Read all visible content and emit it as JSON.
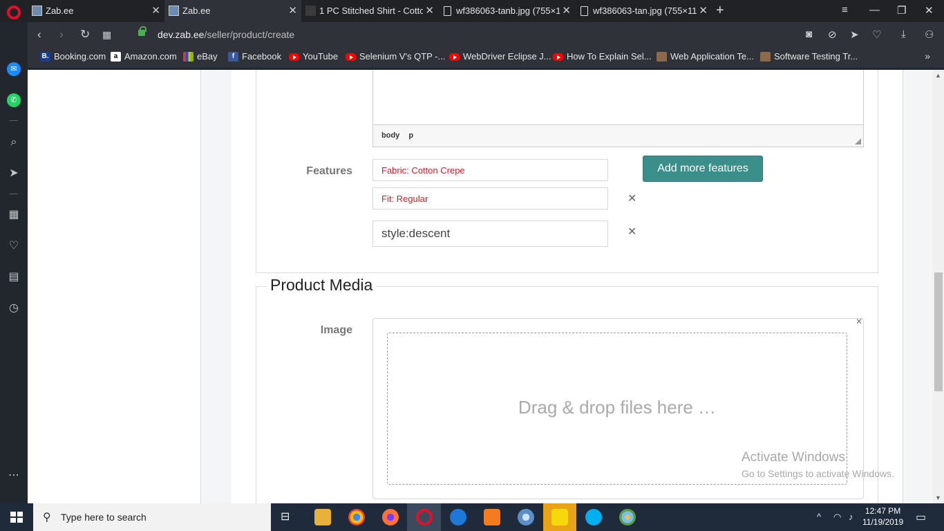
{
  "browser": {
    "tabs": [
      {
        "label": "Zab.ee",
        "active": false
      },
      {
        "label": "Zab.ee",
        "active": true
      },
      {
        "label": "1 PC Stitched Shirt - Cotton",
        "active": false
      },
      {
        "label": "wf386063-tanb.jpg (755×1",
        "active": false
      },
      {
        "label": "wf386063-tan.jpg (755×11",
        "active": false
      }
    ],
    "url_domain": "dev.zab.ee",
    "url_path": "/seller/product/create",
    "bookmarks": [
      {
        "label": "Booking.com",
        "icon": "booking-icon"
      },
      {
        "label": "Amazon.com",
        "icon": "amazon-icon"
      },
      {
        "label": "eBay",
        "icon": "ebay-icon"
      },
      {
        "label": "Facebook",
        "icon": "facebook-icon"
      },
      {
        "label": "YouTube",
        "icon": "youtube-icon"
      },
      {
        "label": "Selenium V's QTP -...",
        "icon": "youtube-icon"
      },
      {
        "label": "WebDriver Eclipse J...",
        "icon": "youtube-icon"
      },
      {
        "label": "How To Explain Sel...",
        "icon": "youtube-icon"
      },
      {
        "label": "Web Application Te...",
        "icon": "cube-icon"
      },
      {
        "label": "Software Testing Tr...",
        "icon": "cube-icon"
      }
    ]
  },
  "editor": {
    "path": [
      "body",
      "p"
    ]
  },
  "features": {
    "label": "Features",
    "items": [
      {
        "value": "Fabric: Cotton Crepe"
      },
      {
        "value": "Fit: Regular"
      },
      {
        "value": "style:descent"
      }
    ],
    "add_button": "Add more features"
  },
  "media": {
    "title": "Product Media",
    "image_label": "Image",
    "dropzone_text": "Drag & drop files here …"
  },
  "watermark": {
    "line1": "Activate Windows",
    "line2": "Go to Settings to activate Windows."
  },
  "taskbar": {
    "search_placeholder": "Type here to search",
    "time": "12:47 PM",
    "date": "11/19/2019"
  },
  "colors": {
    "accent_teal": "#3a8f8a",
    "feature_text_red": "#d0202a",
    "opera_red": "#e0102a"
  }
}
